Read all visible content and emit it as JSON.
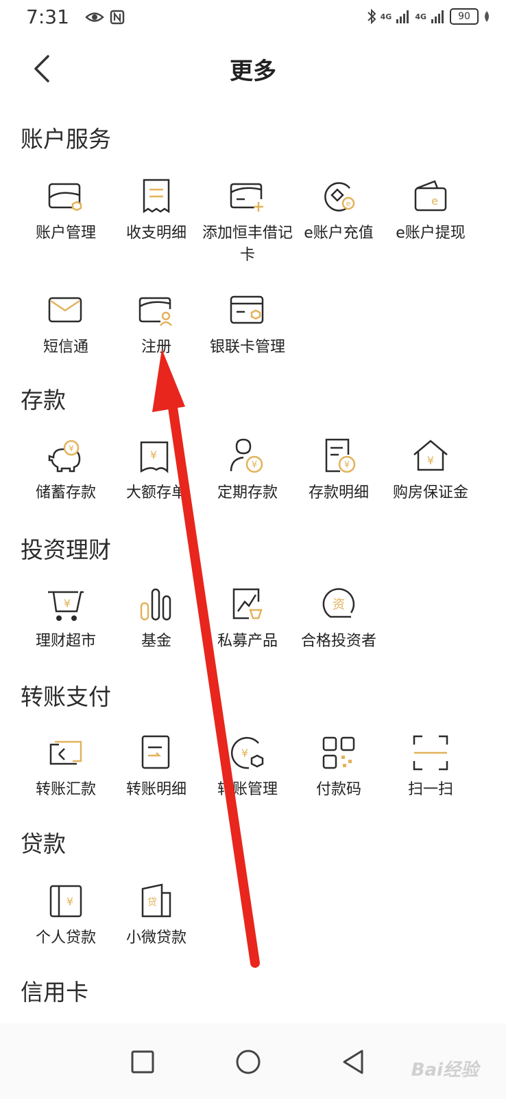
{
  "status_bar": {
    "time": "7:31",
    "network_label_1": "4G",
    "network_label_2": "4G",
    "battery": "90"
  },
  "header": {
    "title": "更多",
    "back_icon": "chevron-left-icon"
  },
  "sections": [
    {
      "title": "账户服务",
      "items": [
        {
          "label": "账户管理",
          "icon": "card-settings-icon"
        },
        {
          "label": "收支明细",
          "icon": "receipt-icon"
        },
        {
          "label": "添加恒丰借记卡",
          "icon": "card-add-icon"
        },
        {
          "label": "e账户充值",
          "icon": "e-recharge-icon"
        },
        {
          "label": "e账户提现",
          "icon": "e-wallet-icon"
        },
        {
          "label": "短信通",
          "icon": "envelope-icon"
        },
        {
          "label": "注册",
          "icon": "card-user-icon"
        },
        {
          "label": "银联卡管理",
          "icon": "unionpay-card-icon"
        }
      ]
    },
    {
      "title": "存款",
      "items": [
        {
          "label": "储蓄存款",
          "icon": "piggy-bank-icon"
        },
        {
          "label": "大额存单",
          "icon": "deposit-certificate-icon"
        },
        {
          "label": "定期存款",
          "icon": "fixed-deposit-icon"
        },
        {
          "label": "存款明细",
          "icon": "deposit-detail-icon"
        },
        {
          "label": "购房保证金",
          "icon": "house-deposit-icon"
        }
      ]
    },
    {
      "title": "投资理财",
      "items": [
        {
          "label": "理财超市",
          "icon": "shopping-cart-icon"
        },
        {
          "label": "基金",
          "icon": "bar-chart-icon"
        },
        {
          "label": "私募产品",
          "icon": "private-fund-icon"
        },
        {
          "label": "合格投资者",
          "icon": "investor-icon"
        }
      ]
    },
    {
      "title": "转账支付",
      "items": [
        {
          "label": "转账汇款",
          "icon": "transfer-icon"
        },
        {
          "label": "转账明细",
          "icon": "transfer-detail-icon"
        },
        {
          "label": "转账管理",
          "icon": "transfer-manage-icon"
        },
        {
          "label": "付款码",
          "icon": "qr-code-icon"
        },
        {
          "label": "扫一扫",
          "icon": "scan-icon"
        }
      ]
    },
    {
      "title": "贷款",
      "items": [
        {
          "label": "个人贷款",
          "icon": "personal-loan-icon"
        },
        {
          "label": "小微贷款",
          "icon": "small-loan-icon"
        }
      ]
    },
    {
      "title": "信用卡",
      "items": []
    }
  ],
  "watermark": "Bai经验",
  "colors": {
    "accent": "#e3b25a",
    "icon_stroke": "#2b2b2b",
    "arrow": "#e8261d"
  }
}
